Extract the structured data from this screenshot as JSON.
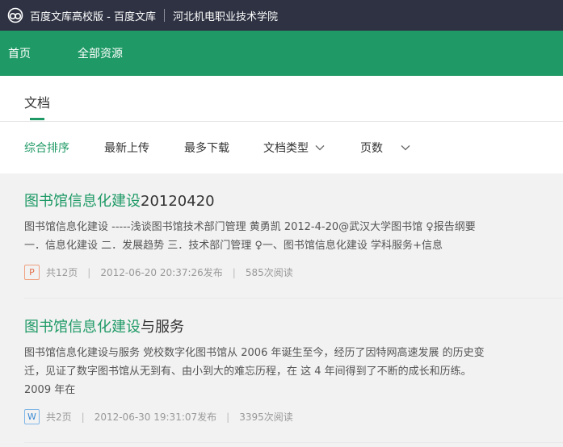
{
  "topbar": {
    "site_title": "百度文库高校版 - 百度文库",
    "school": "河北机电职业技术学院"
  },
  "nav": {
    "home": "首页",
    "all_resources": "全部资源"
  },
  "tabs": {
    "doc": "文档"
  },
  "sort": {
    "items": [
      "综合排序",
      "最新上传",
      "最多下载",
      "文档类型",
      "页数"
    ]
  },
  "results": [
    {
      "title_highlight": "图书馆信息化建设",
      "title_rest": "20120420",
      "snippet_1": "图书馆信息化建设 -----浅谈图书馆技术部门管理 黄勇凯 2012-4-20@武汉大学图书馆 ♀报告纲要",
      "snippet_2": "一．信息化建设 二．发展趋势 三．技术部门管理 ♀一、图书馆信息化建设 学科服务+信息",
      "file_type": "P",
      "pages": "共12页",
      "published": "2012-06-20 20:37:26发布",
      "reads": "585次阅读"
    },
    {
      "title_highlight": "图书馆信息化建设",
      "title_rest": "与服务",
      "snippet_1": "图书馆信息化建设与服务 党校数字化图书馆从 2006 年诞生至今，经历了因特网高速发展 的历史变",
      "snippet_2": "迁，见证了数字图书馆从无到有、由小到大的难忘历程，在 这 4 年间得到了不断的成长和历练。",
      "snippet_3": "2009 年在",
      "file_type": "W",
      "pages": "共2页",
      "published": "2012-06-30 19:31:07发布",
      "reads": "3395次阅读"
    }
  ],
  "colors": {
    "topbar": "#2e3242",
    "brand_green": "#1f9a66",
    "page_bg": "#f2f2f2"
  },
  "icons": {
    "logo": "baidu-wenku-logo-icon",
    "dropdown": "chevron-down-icon"
  }
}
